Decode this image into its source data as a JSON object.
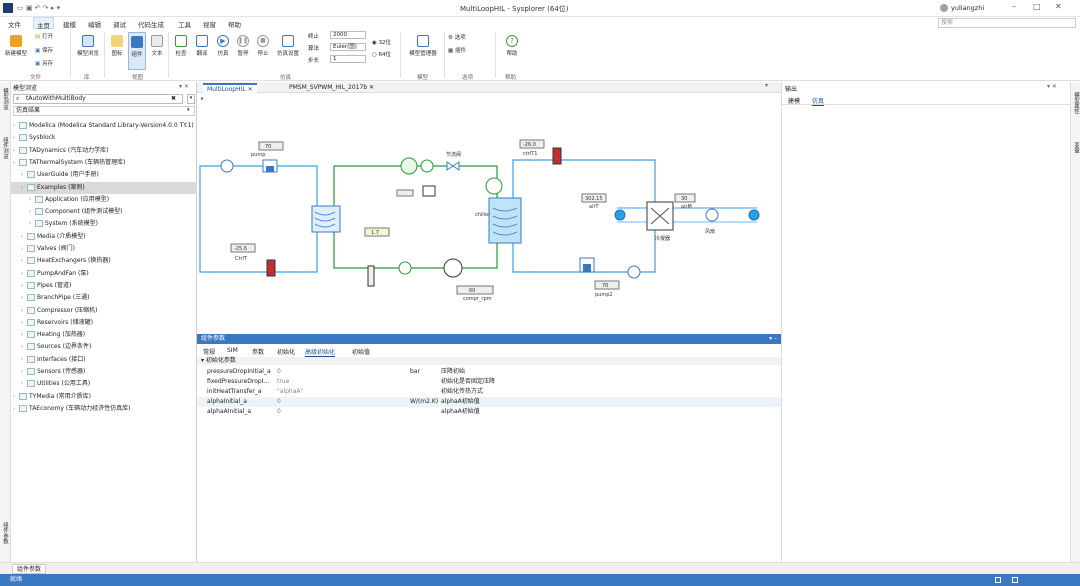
{
  "titlebar": {
    "title": "MultiLoopHIL - Sysplorer (64位)",
    "user": "yuliangzhi"
  },
  "menu": [
    "文件",
    "主页",
    "建模",
    "编辑",
    "调试",
    "代码生成",
    "工具",
    "视窗",
    "帮助"
  ],
  "ribbon": {
    "buttons": [
      {
        "label": "新建模型"
      },
      {
        "label": "打开"
      },
      {
        "label": "保存"
      },
      {
        "label": "另存"
      },
      {
        "label": "模型浏览"
      },
      {
        "label": "图标"
      },
      {
        "label": "组件"
      },
      {
        "label": "文本"
      },
      {
        "label": "检查"
      },
      {
        "label": "翻译"
      },
      {
        "label": "仿真"
      },
      {
        "label": "暂停"
      },
      {
        "label": "停止"
      },
      {
        "label": "仿真设置"
      },
      {
        "label": "模型管理器"
      },
      {
        "label": "选项"
      },
      {
        "label": "插件"
      },
      {
        "label": "帮助"
      }
    ],
    "sim_fields": {
      "stop_time_label": "终止",
      "stop_time": "2000",
      "algo_label": "算法",
      "algo": "Euler(固)",
      "step_label": "步长",
      "step": "1"
    },
    "radio_32": "32位",
    "radio_64": "64位",
    "groups": [
      "文件",
      "库",
      "视图",
      "仿真",
      "模型",
      "选项",
      "帮助"
    ]
  },
  "left_tabs": {
    "tab1": "模型浏览",
    "tab2": "组件浏览",
    "tab3": "组件参数"
  },
  "tree": {
    "header": "模型浏览",
    "search_value": "tAutoWithMultiBody",
    "section": "仿真结果",
    "items": [
      {
        "label": "Modelica (Modelica Standard Library-Version4.0.0 TY.1)",
        "indent": 0,
        "sel": false
      },
      {
        "label": "Sysblock",
        "indent": 0,
        "sel": false
      },
      {
        "label": "TADynamics (汽车动力学库)",
        "indent": 0,
        "sel": false
      },
      {
        "label": "TAThermalSystem (车辆热管理库)",
        "indent": 0,
        "sel": false
      },
      {
        "label": "UserGuide (用户手册)",
        "indent": 1,
        "sel": false
      },
      {
        "label": "Examples (案例)",
        "indent": 1,
        "sel": true
      },
      {
        "label": "Application (应用模型)",
        "indent": 2,
        "sel": false
      },
      {
        "label": "Component (组件测试模型)",
        "indent": 2,
        "sel": false
      },
      {
        "label": "System (系统模型)",
        "indent": 2,
        "sel": false
      },
      {
        "label": "Media (介质模型)",
        "indent": 1,
        "sel": false
      },
      {
        "label": "Valves (阀门)",
        "indent": 1,
        "sel": false
      },
      {
        "label": "HeatExchangers (换热器)",
        "indent": 1,
        "sel": false
      },
      {
        "label": "PumpAndFan (泵)",
        "indent": 1,
        "sel": false
      },
      {
        "label": "Pipes (管道)",
        "indent": 1,
        "sel": false
      },
      {
        "label": "BranchPipe (三通)",
        "indent": 1,
        "sel": false
      },
      {
        "label": "Compressor (压缩机)",
        "indent": 1,
        "sel": false
      },
      {
        "label": "Reservoirs (储液罐)",
        "indent": 1,
        "sel": false
      },
      {
        "label": "Heating (加热器)",
        "indent": 1,
        "sel": false
      },
      {
        "label": "Sources (边界条件)",
        "indent": 1,
        "sel": false
      },
      {
        "label": "Interfaces (接口)",
        "indent": 1,
        "sel": false
      },
      {
        "label": "Sensors (传感器)",
        "indent": 1,
        "sel": false
      },
      {
        "label": "Utilities (公用工具)",
        "indent": 1,
        "sel": false
      },
      {
        "label": "TYMedia (常用介质库)",
        "indent": 0,
        "sel": false
      },
      {
        "label": "TAEconomy (车辆动力经济性仿真库)",
        "indent": 0,
        "sel": false
      }
    ]
  },
  "doc_tabs": [
    {
      "label": "MultiLoopHIL",
      "active": true
    },
    {
      "label": "PMSM_SVPWM_HIL_2017b",
      "active": false
    }
  ],
  "diagram": {
    "pump1_speed": "70",
    "pump1_label": "pump",
    "ctrl1": "-25.6",
    "ctrl1_label": "CtrlT",
    "ctrl2": "-26.0",
    "ctrl2_label": "ctrlT1",
    "valve_label": "节流阀",
    "exp_value": "1.7",
    "comp_speed": "60",
    "comp_label": "compr_rpm",
    "air_temp": "302.15",
    "air_label": "airT",
    "air_flow": "30",
    "air_flow_label": "airM",
    "pump2_speed": "70",
    "pump2_label": "pump2",
    "fan_label": "风扇",
    "chiller_label": "chiller",
    "cond_label": "冷凝器"
  },
  "props": {
    "header": "组件参数",
    "tabs": [
      "常规",
      "SIM",
      "参数",
      "初始化",
      "高级初始化",
      "初始值"
    ],
    "section": "初始化参数",
    "rows": [
      {
        "name": "pressureDropInitial_a",
        "value": "0",
        "unit": "bar",
        "desc": "压降初始"
      },
      {
        "name": "fixedPressureDropI...",
        "value": "true",
        "unit": "",
        "desc": "初始化是否固定压降"
      },
      {
        "name": "initHeatTransfer_a",
        "value": "\"alphaA\"",
        "unit": "",
        "desc": "初始化传热方式"
      },
      {
        "name": "alphaInitial_a",
        "value": "0",
        "unit": "W/(m2.K)",
        "desc": "alphaA初始值"
      },
      {
        "name": "alphaAInitial_a",
        "value": "0",
        "unit": "",
        "desc": "alphaA初始值"
      }
    ]
  },
  "right_panel": {
    "header": "输出",
    "tab1": "建模",
    "tab2": "仿真"
  },
  "right_tabs": {
    "tab1": "模型属性",
    "tab2": "变量"
  },
  "bottom_tab": "组件参数",
  "status": "就绪",
  "search_placeholder": "搜索"
}
